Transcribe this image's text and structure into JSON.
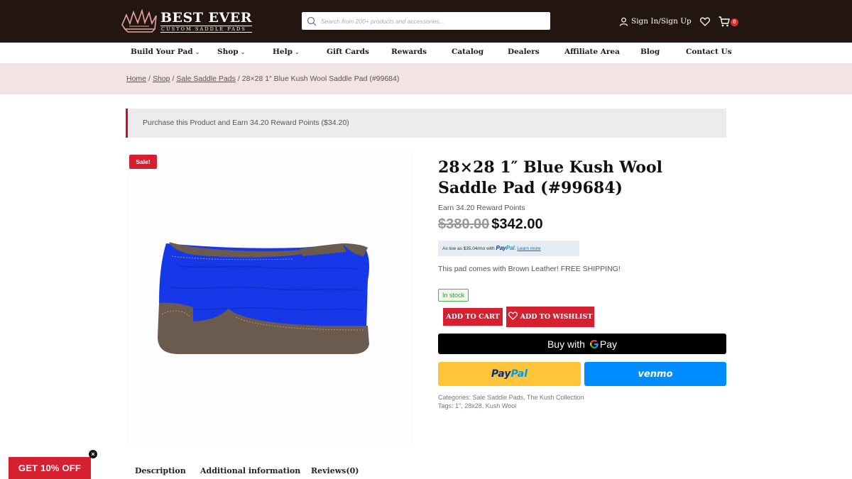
{
  "brand": {
    "name": "BEST EVER",
    "tagline": "CUSTOM SADDLE PADS"
  },
  "search": {
    "placeholder": "Search from 200+ products and accessories..."
  },
  "header": {
    "signin_label": "Sign In/Sign Up",
    "cart_count": "0"
  },
  "nav": {
    "items": [
      {
        "label": "Build Your Pad",
        "dropdown": true
      },
      {
        "label": "Shop",
        "dropdown": true
      },
      {
        "label": "Help",
        "dropdown": true
      },
      {
        "label": "Gift Cards"
      },
      {
        "label": "Rewards"
      },
      {
        "label": "Catalog"
      },
      {
        "label": "Dealers"
      },
      {
        "label": "Affiliate Area"
      },
      {
        "label": "Blog"
      },
      {
        "label": "Contact Us"
      }
    ]
  },
  "breadcrumb": {
    "home": "Home",
    "shop": "Shop",
    "category": "Sale Saddle Pads",
    "current": "28×28 1″ Blue Kush Wool Saddle Pad (#99684)",
    "separator": "/"
  },
  "notice": {
    "text": "Purchase this Product and Earn 34.20 Reward Points ($34.20)"
  },
  "product": {
    "sale_badge": "Sale!",
    "title": "28×28 1″ Blue Kush Wool Saddle Pad (#99684)",
    "earn_points": "Earn 34.20 Reward Points",
    "old_price": "$380.00",
    "price": "$342.00",
    "paypal_msg": {
      "prefix": "As low as $35.04/mo with",
      "pay": "Pay",
      "pal": "Pal",
      "link": "Learn more"
    },
    "short_description": "This pad comes with Brown Leather! FREE SHIPPING!",
    "stock": "In stock",
    "add_to_cart": "ADD TO CART",
    "add_to_wishlist": "ADD TO WISHLIST",
    "gpay_label": "Buy with",
    "gpay_brand": "Pay",
    "paypal_pay": "Pay",
    "paypal_pal": "Pal",
    "venmo": "venmo",
    "categories_label": "Categories:",
    "categories": "Sale Saddle Pads, The Kush Collection",
    "tags_label": "Tags:",
    "tags": "1\", 28x28, Kush Wool"
  },
  "tabs": [
    "Description",
    "Additional information",
    "Reviews(0)"
  ],
  "promo": {
    "label": "GET 10% OFF",
    "close": "×"
  },
  "colors": {
    "header_bg": "#231510",
    "accent_red": "#d6202f",
    "pad_blue": "#1436e6",
    "leather": "#6b5a4e"
  }
}
